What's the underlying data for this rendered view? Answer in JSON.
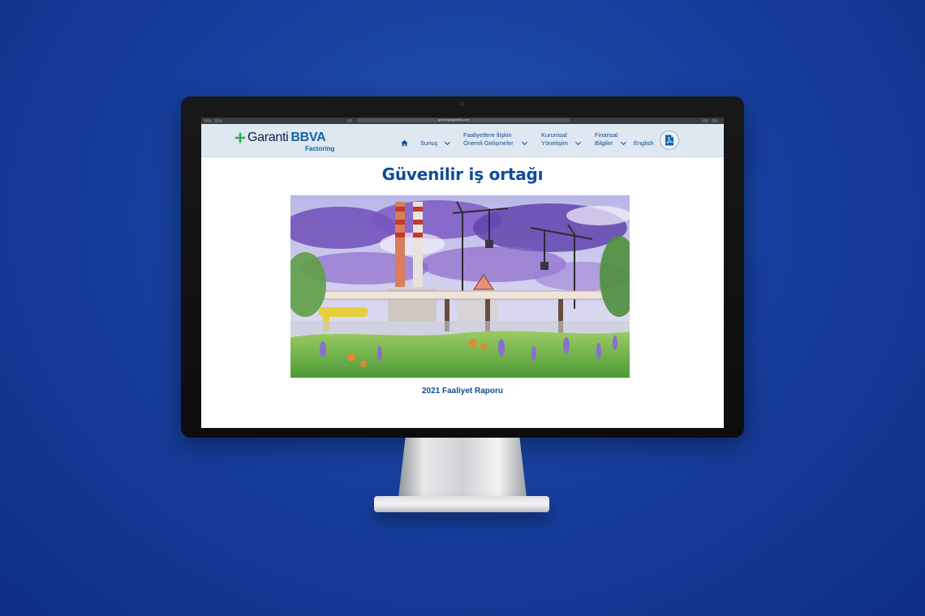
{
  "browser": {
    "url": "gelecegingaranti.com"
  },
  "brand": {
    "name": "Garanti",
    "name_accent": "BBVA",
    "subtitle": "Factoring"
  },
  "nav": {
    "home_icon": "home-icon",
    "items": [
      {
        "lines": [
          "Sunuş"
        ],
        "has_dropdown": true
      },
      {
        "lines": [
          "Faaliyetlere İlişkin",
          "Önemli Gelişmeler"
        ],
        "has_dropdown": true
      },
      {
        "lines": [
          "Kurumsal",
          "Yönetişim"
        ],
        "has_dropdown": true
      },
      {
        "lines": [
          "Finansal",
          "Bilgiler"
        ],
        "has_dropdown": true
      },
      {
        "lines": [
          "English"
        ],
        "has_dropdown": false
      }
    ],
    "pdf_icon": "pdf-icon"
  },
  "main": {
    "title": "Güvenilir iş ortağı",
    "illustration": "watercolor-industrial-landscape",
    "report_label": "2021 Faaliyet Raporu"
  },
  "colors": {
    "background": "#173f9d",
    "brand_blue": "#0e4b9b",
    "header_bg": "#dfe7f0",
    "logo_green": "#2ab34b"
  }
}
